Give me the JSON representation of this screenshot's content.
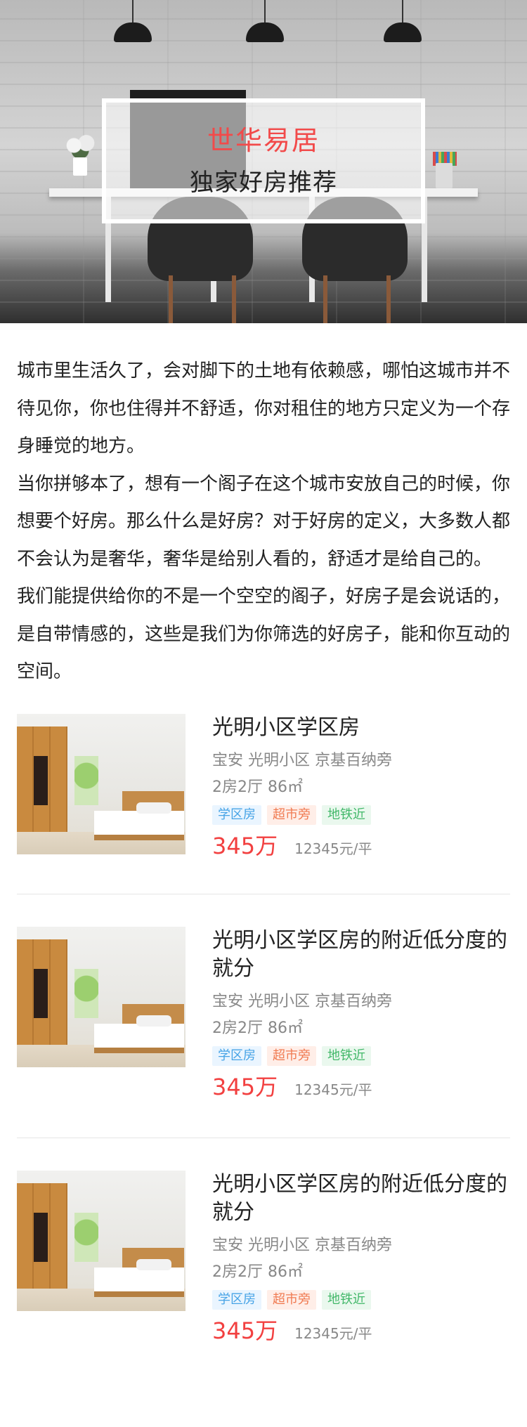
{
  "hero": {
    "title": "世华易居",
    "subtitle": "独家好房推荐"
  },
  "intro": {
    "paragraphs": [
      "城市里生活久了，会对脚下的土地有依赖感，哪怕这城市并不待见你，你也住得并不舒适，你对租住的地方只定义为一个存身睡觉的地方。",
      "当你拼够本了，想有一个阁子在这个城市安放自己的时候，你想要个好房。那么什么是好房？对于好房的定义，大多数人都不会认为是奢华，奢华是给别人看的，舒适才是给自己的。",
      "我们能提供给你的不是一个空空的阁子，好房子是会说话的，是自带情感的，这些是我们为你筛选的好房子，能和你互动的空间。"
    ]
  },
  "listings": [
    {
      "name": "光明小区学区房",
      "address": "宝安  光明小区  京基百纳旁",
      "spec": "2房2厅   86㎡",
      "tags": [
        "学区房",
        "超市旁",
        "地铁近"
      ],
      "price": "345万",
      "unit_price": "12345元/平"
    },
    {
      "name": "光明小区学区房的附近低分度的就分",
      "address": "宝安  光明小区  京基百纳旁",
      "spec": "2房2厅   86㎡",
      "tags": [
        "学区房",
        "超市旁",
        "地铁近"
      ],
      "price": "345万",
      "unit_price": "12345元/平"
    },
    {
      "name": "光明小区学区房的附近低分度的就分",
      "address": "宝安  光明小区  京基百纳旁",
      "spec": "2房2厅   86㎡",
      "tags": [
        "学区房",
        "超市旁",
        "地铁近"
      ],
      "price": "345万",
      "unit_price": "12345元/平"
    }
  ],
  "colors": {
    "accent_red": "#f24a4a",
    "tag_blue": "#46a3e6",
    "tag_orange": "#f07b52",
    "tag_green": "#43b86a"
  }
}
